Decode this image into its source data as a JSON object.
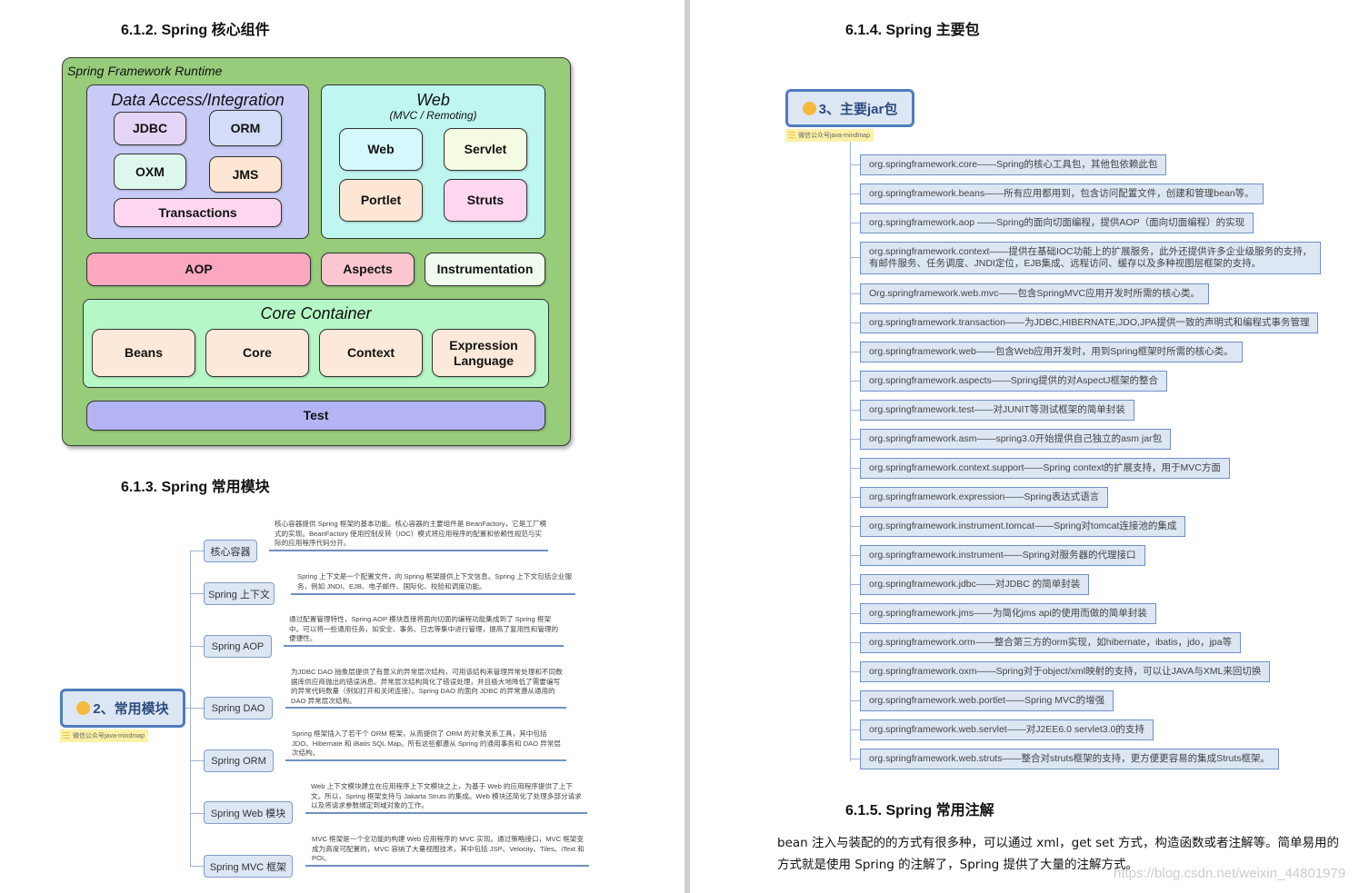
{
  "sections": {
    "core_components": "6.1.2.  Spring 核心组件",
    "common_modules": "6.1.3.  Spring 常用模块",
    "main_packages": "6.1.4.  Spring 主要包",
    "common_annotations": "6.1.5.  Spring 常用注解"
  },
  "framework_diagram": {
    "title": "Spring Framework Runtime",
    "data_access": {
      "title": "Data Access/Integration",
      "modules": [
        "JDBC",
        "ORM",
        "OXM",
        "JMS",
        "Transactions"
      ]
    },
    "web": {
      "title": "Web",
      "subtitle": "(MVC / Remoting)",
      "modules": [
        "Web",
        "Servlet",
        "Portlet",
        "Struts"
      ]
    },
    "middle": [
      "AOP",
      "Aspects",
      "Instrumentation"
    ],
    "core_container": {
      "title": "Core Container",
      "modules": [
        "Beans",
        "Core",
        "Context",
        "Expression Language"
      ]
    },
    "test": "Test",
    "colors": {
      "runtime": "#97cc7b",
      "data_access": "#c9cbf7",
      "web": "#bff7f0",
      "core_container": "#b5f7c5",
      "aop": "#fba7bf",
      "aspects": "#fac6cf",
      "instrumentation": "#f1fbee",
      "core_module": "#fde9d9",
      "test": "#b4b4f5"
    }
  },
  "modules_mindmap": {
    "root": "2、常用模块",
    "note": "微信公众号java-mindmap",
    "nodes": [
      {
        "label": "核心容器",
        "desc": "核心容器提供 Spring 框架的基本功能。核心容器的主要组件是 BeanFactory，它是工厂模式的实现。BeanFactory 使用控制反转（IOC）模式将应用程序的配置和依赖性规范与实际的应用程序代码分开。"
      },
      {
        "label": "Spring 上下文",
        "desc": "Spring 上下文是一个配置文件，向 Spring 框架提供上下文信息。Spring 上下文包括企业服务，例如 JNDI、EJB、电子邮件、国际化、校验和调度功能。"
      },
      {
        "label": "Spring AOP",
        "desc": "通过配置管理特性，Spring AOP 模块直接将面向切面的编程功能集成到了 Spring 框架中。可以将一些通用任务，如安全、事务、日志等集中进行管理，提高了复用性和管理的便捷性。"
      },
      {
        "label": "Spring DAO",
        "desc": "为JDBC DAO 抽象层提供了有意义的异常层次结构，可用该结构来管理异常处理和不同数据库供应商抛出的错误消息。异常层次结构简化了错误处理，并且极大地降低了需要编写的异常代码数量（例如打开和关闭连接）。Spring DAO 的面向 JDBC 的异常遵从通用的 DAO 异常层次结构。"
      },
      {
        "label": "Spring ORM",
        "desc": "Spring 框架插入了若干个 ORM 框架，从而提供了 ORM 的对象关系工具，其中包括 JDO、Hibernate 和 iBatis SQL Map。所有这些都遵从 Spring 的通用事务和 DAO 异常层次结构。"
      },
      {
        "label": "Spring Web 模块",
        "desc": "Web 上下文模块建立在应用程序上下文模块之上，为基于 Web 的应用程序提供了上下文。所以，Spring 框架支持与 Jakarta Struts 的集成。Web 模块还简化了处理多部分请求以及将请求参数绑定到域对象的工作。"
      },
      {
        "label": "Spring MVC 框架",
        "desc": "MVC 框架是一个全功能的构建 Web 应用程序的 MVC 实现。通过策略接口，MVC 框架变成为高度可配置的，MVC 容纳了大量视图技术，其中包括 JSP、Velocity、Tiles、iText 和 POI。"
      }
    ]
  },
  "jar_mindmap": {
    "root": "3、主要jar包",
    "note": "微信公众号java-mindmap",
    "items": [
      "org.springframework.core——Spring的核心工具包，其他包依赖此包",
      "org.springframework.beans——所有应用都用到，包含访问配置文件，创建和管理bean等。",
      "org.springframework.aop ——Spring的面向切面编程，提供AOP（面向切面编程）的实现",
      "org.springframework.context——提供在基础IOC功能上的扩展服务，此外还提供许多企业级服务的支持，\n有邮件服务、任务调度、JNDI定位，EJB集成、远程访问、缓存以及多种视图层框架的支持。",
      "Org.springframework.web.mvc——包含SpringMVC应用开发时所需的核心类。",
      "org.springframework.transaction——为JDBC,HIBERNATE,JDO,JPA提供一致的声明式和编程式事务管理",
      "org.springframework.web——包含Web应用开发时，用到Spring框架时所需的核心类。",
      "org.springframework.aspects——Spring提供的对AspectJ框架的整合",
      "org.springframework.test——对JUNIT等测试框架的简单封装",
      "org.springframework.asm——spring3.0开始提供自己独立的asm jar包",
      "org.springframework.context.support——Spring context的扩展支持，用于MVC方面",
      "org.springframework.expression——Spring表达式语言",
      "org.springframework.instrument.tomcat——Spring对tomcat连接池的集成",
      "org.springframework.instrument——Spring对服务器的代理接口",
      "org.springframework.jdbc——对JDBC 的简单封装",
      "org.springframework.jms——为简化jms api的使用而做的简单封装",
      "org.springframework.orm——整合第三方的orm实现，如hibernate，ibatis，jdo，jpa等",
      "org.springframework.oxm——Spring对于object/xml映射的支持，可以让JAVA与XML来回切换",
      "org.springframework.web.portlet——Spring MVC的增强",
      "org.springframework.web.servlet——对J2EE6.0 servlet3.0的支持",
      "org.springframework.web.struts——整合对struts框架的支持，更方便更容易的集成Struts框架。"
    ]
  },
  "annotations_paragraph": "bean 注入与装配的的方式有很多种，可以通过 xml，get set 方式，构造函数或者注解等。简单易用的方式就是使用 Spring 的注解了，Spring 提供了大量的注解方式。",
  "watermark": "https://blog.csdn.net/weixin_44801979"
}
